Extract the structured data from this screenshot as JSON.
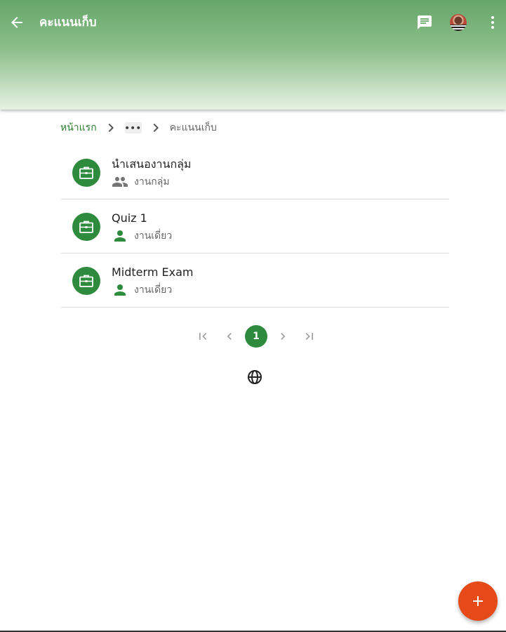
{
  "appbar": {
    "title": "คะแนนเก็บ",
    "back_icon": "arrow-back-icon",
    "chat_icon": "chat-icon",
    "more_icon": "more-vert-icon"
  },
  "breadcrumb": {
    "home": "หน้าแรก",
    "ellipsis": "•••",
    "current": "คะแนนเก็บ"
  },
  "items": [
    {
      "name": "นำเสนองานกลุ่ม",
      "type": "งานกลุ่ม",
      "type_icon": "group-icon"
    },
    {
      "name": "Quiz 1",
      "type": "งานเดี่ยว",
      "type_icon": "person-icon"
    },
    {
      "name": "Midterm Exam",
      "type": "งานเดี่ยว",
      "type_icon": "person-icon"
    }
  ],
  "pagination": {
    "current_page": "1"
  },
  "colors": {
    "primary": "#2e8b3e",
    "fab": "#e64a19",
    "appbar_top": "#66a66a"
  }
}
